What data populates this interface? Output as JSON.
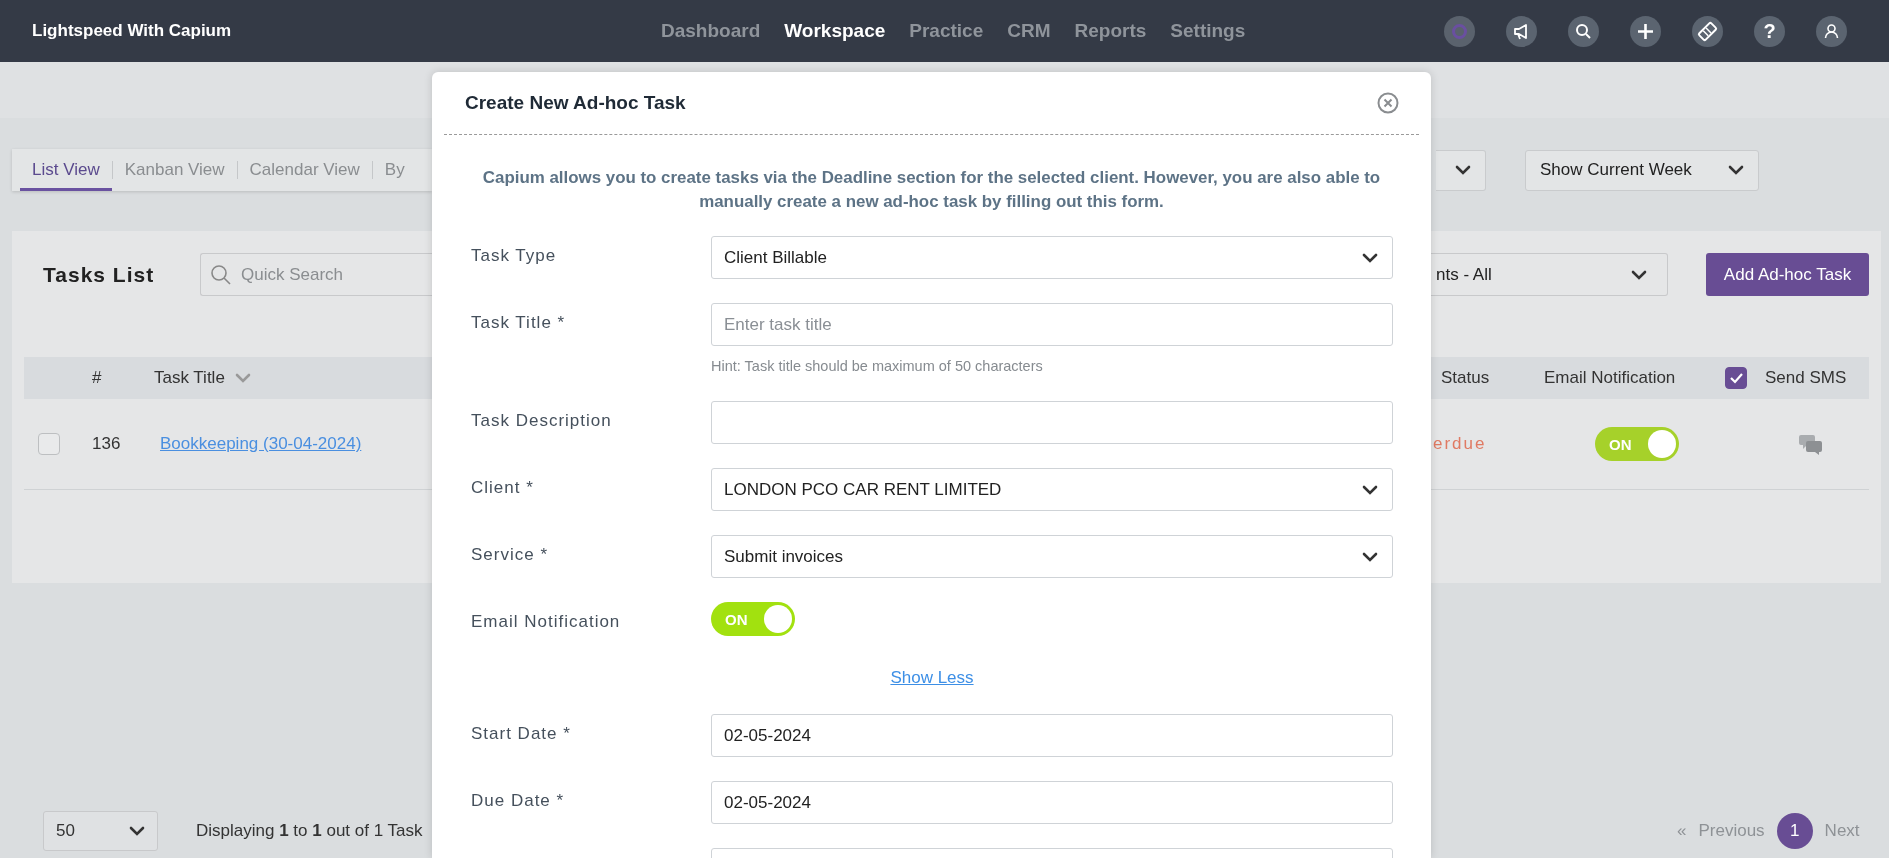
{
  "top_bar": {
    "brand": "Lightspeed With Capium",
    "nav": [
      {
        "label": "Dashboard",
        "selected": false
      },
      {
        "label": "Workspace",
        "selected": true
      },
      {
        "label": "Practice",
        "selected": false
      },
      {
        "label": "CRM",
        "selected": false
      },
      {
        "label": "Reports",
        "selected": false
      },
      {
        "label": "Settings",
        "selected": false
      }
    ],
    "icons": [
      {
        "kind": "logo"
      },
      {
        "kind": "megaphone"
      },
      {
        "kind": "search"
      },
      {
        "kind": "plus"
      },
      {
        "kind": "ticket"
      },
      {
        "kind": "help",
        "text": "?"
      },
      {
        "kind": "user"
      }
    ]
  },
  "view_tabs": [
    {
      "label": "List View",
      "selected": true
    },
    {
      "label": "Kanban View",
      "selected": false
    },
    {
      "label": "Calendar View",
      "selected": false
    },
    {
      "label": "By",
      "selected": false
    }
  ],
  "filters": [
    {
      "kind": "select"
    },
    {
      "kind": "select",
      "value": "Show Current Week"
    }
  ],
  "tasks_panel": {
    "title": "Tasks List",
    "search": {
      "placeholder": "Quick Search"
    },
    "filter": {
      "value": "nts - All"
    },
    "add_button": "Add Ad-hoc Task",
    "columns": [
      {
        "label": "#"
      },
      {
        "label": "Task Title",
        "sortable": true
      },
      {
        "label": "Status"
      },
      {
        "label": "Email Notification"
      },
      {
        "label": "Send SMS",
        "checked": true
      }
    ],
    "rows": [
      {
        "checked": false,
        "number": "136",
        "title": "Bookkeeping (30-04-2024)",
        "status": "erdue",
        "email_notification": true,
        "toggle_text": "ON"
      }
    ]
  },
  "footer": {
    "page_size": "50",
    "summary": "Displaying **1** to **1** out of 1 Task",
    "pagination": {
      "first": {
        "label": "«",
        "disabled": true
      },
      "previous": {
        "label": "Previous",
        "disabled": true
      },
      "pages": [
        {
          "label": "1",
          "selected": true
        }
      ],
      "next": {
        "label": "Next",
        "disabled": true
      }
    }
  },
  "modal": {
    "title": "Create New Ad-hoc Task",
    "intro": "Capium allows you to create tasks via the Deadline section for the selected client. However, you are also able to manually create a new ad-hoc task by filling out this form.",
    "fields": [
      {
        "kind": "select",
        "label": "Task Type",
        "value": "Client Billable"
      },
      {
        "kind": "input",
        "label": "Task Title *",
        "placeholder": "Enter task title",
        "hint": "Hint: Task title should be maximum of 50 characters"
      },
      {
        "kind": "input",
        "label": "Task Description"
      },
      {
        "kind": "select",
        "label": "Client *",
        "value": "LONDON PCO CAR RENT LIMITED"
      },
      {
        "kind": "select",
        "label": "Service *",
        "value": "Submit invoices"
      },
      {
        "kind": "toggle",
        "label": "Email Notification",
        "on": true,
        "text": "ON"
      },
      {
        "kind": "link",
        "text": "Show Less"
      },
      {
        "kind": "input",
        "label": "Start Date *",
        "value": "02-05-2024"
      },
      {
        "kind": "input",
        "label": "Due Date *",
        "value": "02-05-2024"
      },
      {
        "kind": "input"
      }
    ]
  }
}
